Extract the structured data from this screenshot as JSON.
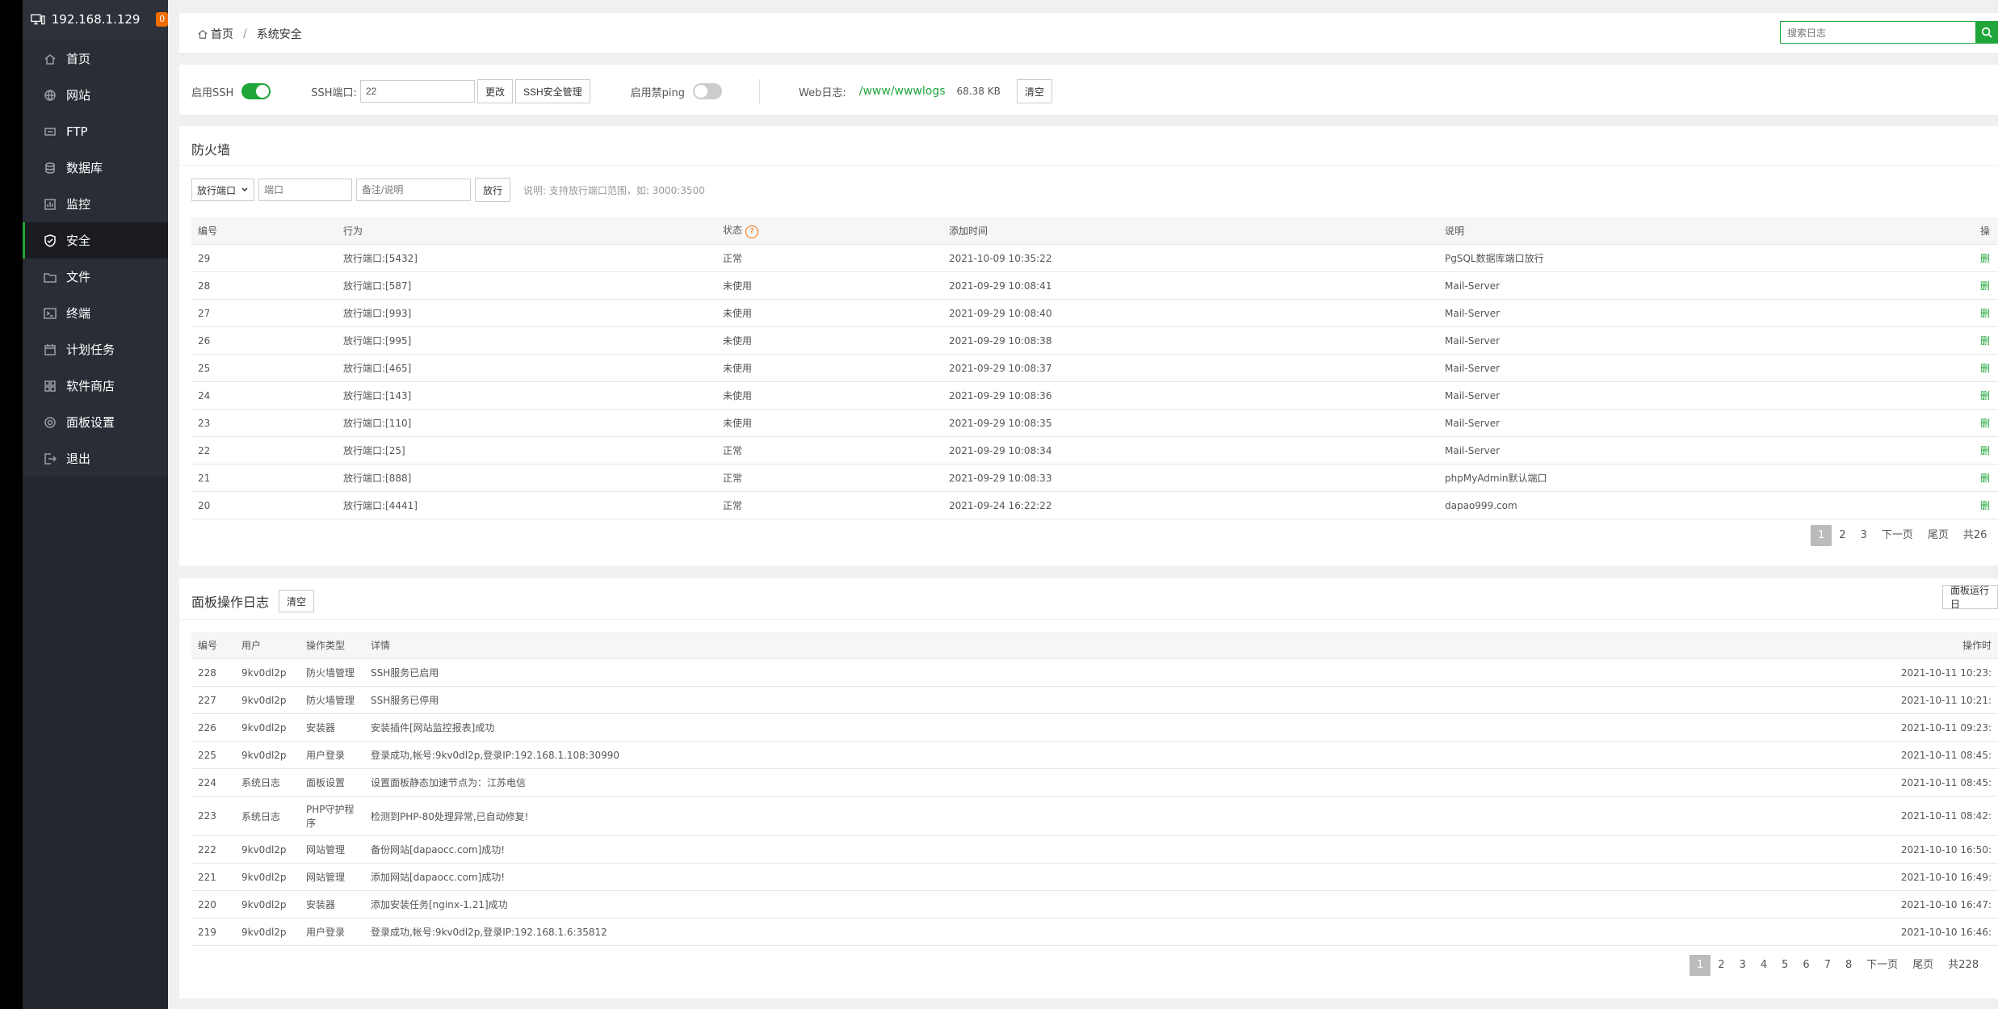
{
  "sidebar": {
    "ip": "192.168.1.129",
    "badge": "0",
    "items": [
      {
        "label": "首页"
      },
      {
        "label": "网站"
      },
      {
        "label": "FTP"
      },
      {
        "label": "数据库"
      },
      {
        "label": "监控"
      },
      {
        "label": "安全"
      },
      {
        "label": "文件"
      },
      {
        "label": "终端"
      },
      {
        "label": "计划任务"
      },
      {
        "label": "软件商店"
      },
      {
        "label": "面板设置"
      },
      {
        "label": "退出"
      }
    ]
  },
  "header": {
    "home": "首页",
    "sep": "/",
    "current": "系统安全",
    "search_placeholder": "搜索日志"
  },
  "ssh": {
    "enable_label": "启用SSH",
    "port_label": "SSH端口:",
    "port_value": "22",
    "change_btn": "更改",
    "manage_btn": "SSH安全管理",
    "ping_label": "启用禁ping",
    "weblog_label": "Web日志:",
    "weblog_path": "/www/wwwlogs",
    "weblog_size": "68.38 KB",
    "clear_btn": "清空"
  },
  "firewall": {
    "title": "防火墙",
    "select_value": "放行端口",
    "port_placeholder": "端口",
    "note_placeholder": "备注/说明",
    "allow_btn": "放行",
    "hint": "说明: 支持放行端口范围，如: 3000:3500",
    "headers": [
      "编号",
      "行为",
      "状态",
      "添加时间",
      "说明",
      "操"
    ],
    "rows": [
      {
        "id": "29",
        "action": "放行端口:[5432]",
        "status": "正常",
        "time": "2021-10-09 10:35:22",
        "note": "PgSQL数据库端口放行",
        "op": "删"
      },
      {
        "id": "28",
        "action": "放行端口:[587]",
        "status": "未使用",
        "time": "2021-09-29 10:08:41",
        "note": "Mail-Server",
        "op": "删"
      },
      {
        "id": "27",
        "action": "放行端口:[993]",
        "status": "未使用",
        "time": "2021-09-29 10:08:40",
        "note": "Mail-Server",
        "op": "删"
      },
      {
        "id": "26",
        "action": "放行端口:[995]",
        "status": "未使用",
        "time": "2021-09-29 10:08:38",
        "note": "Mail-Server",
        "op": "删"
      },
      {
        "id": "25",
        "action": "放行端口:[465]",
        "status": "未使用",
        "time": "2021-09-29 10:08:37",
        "note": "Mail-Server",
        "op": "删"
      },
      {
        "id": "24",
        "action": "放行端口:[143]",
        "status": "未使用",
        "time": "2021-09-29 10:08:36",
        "note": "Mail-Server",
        "op": "删"
      },
      {
        "id": "23",
        "action": "放行端口:[110]",
        "status": "未使用",
        "time": "2021-09-29 10:08:35",
        "note": "Mail-Server",
        "op": "删"
      },
      {
        "id": "22",
        "action": "放行端口:[25]",
        "status": "正常",
        "time": "2021-09-29 10:08:34",
        "note": "Mail-Server",
        "op": "删"
      },
      {
        "id": "21",
        "action": "放行端口:[888]",
        "status": "正常",
        "time": "2021-09-29 10:08:33",
        "note": "phpMyAdmin默认端口",
        "op": "删"
      },
      {
        "id": "20",
        "action": "放行端口:[4441]",
        "status": "正常",
        "time": "2021-09-24 16:22:22",
        "note": "dapao999.com",
        "op": "删"
      }
    ],
    "pager": [
      "1",
      "2",
      "3",
      "下一页",
      "尾页",
      "共26"
    ]
  },
  "logs": {
    "title": "面板操作日志",
    "clear_btn": "清空",
    "run_log_btn": "面板运行日",
    "headers": [
      "编号",
      "用户",
      "操作类型",
      "详情",
      "操作时"
    ],
    "rows": [
      {
        "id": "228",
        "user": "9kv0dl2p",
        "type": "防火墙管理",
        "detail": "SSH服务已启用",
        "time": "2021-10-11 10:23:"
      },
      {
        "id": "227",
        "user": "9kv0dl2p",
        "type": "防火墙管理",
        "detail": "SSH服务已停用",
        "time": "2021-10-11 10:21:"
      },
      {
        "id": "226",
        "user": "9kv0dl2p",
        "type": "安装器",
        "detail": "安装插件[网站监控报表]成功",
        "time": "2021-10-11 09:23:"
      },
      {
        "id": "225",
        "user": "9kv0dl2p",
        "type": "用户登录",
        "detail": "登录成功,帐号:9kv0dl2p,登录IP:192.168.1.108:30990",
        "time": "2021-10-11 08:45:"
      },
      {
        "id": "224",
        "user": "系统日志",
        "type": "面板设置",
        "detail": "设置面板静态加速节点为：江苏电信",
        "time": "2021-10-11 08:45:"
      },
      {
        "id": "223",
        "user": "系统日志",
        "type": "PHP守护程序",
        "detail": "检测到PHP-80处理异常,已自动修复!",
        "time": "2021-10-11 08:42:"
      },
      {
        "id": "222",
        "user": "9kv0dl2p",
        "type": "网站管理",
        "detail": "备份网站[dapaocc.com]成功!",
        "time": "2021-10-10 16:50:"
      },
      {
        "id": "221",
        "user": "9kv0dl2p",
        "type": "网站管理",
        "detail": "添加网站[dapaocc.com]成功!",
        "time": "2021-10-10 16:49:"
      },
      {
        "id": "220",
        "user": "9kv0dl2p",
        "type": "安装器",
        "detail": "添加安装任务[nginx-1.21]成功",
        "time": "2021-10-10 16:47:"
      },
      {
        "id": "219",
        "user": "9kv0dl2p",
        "type": "用户登录",
        "detail": "登录成功,帐号:9kv0dl2p,登录IP:192.168.1.6:35812",
        "time": "2021-10-10 16:46:"
      }
    ],
    "pager": [
      "1",
      "2",
      "3",
      "4",
      "5",
      "6",
      "7",
      "8",
      "下一页",
      "尾页",
      "共228"
    ]
  }
}
